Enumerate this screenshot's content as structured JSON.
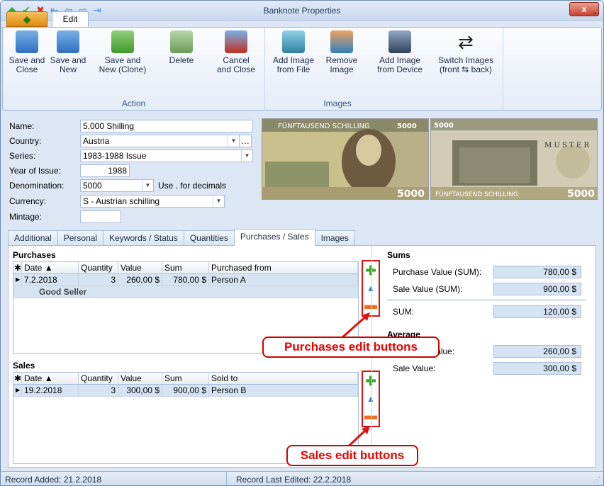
{
  "window": {
    "title": "Banknote Properties",
    "close_glyph": "x"
  },
  "ribbon": {
    "app_tab_glyph": "◆",
    "tab_edit": "Edit",
    "groups": {
      "action": "Action",
      "images": "Images"
    },
    "buttons": {
      "save_close": "Save and\nClose",
      "save_new": "Save and\nNew",
      "save_clone": "Save and\nNew (Clone)",
      "delete": "Delete",
      "cancel_close": "Cancel\nand Close",
      "add_image_file": "Add Image\nfrom File",
      "remove_image": "Remove\nImage",
      "add_image_device": "Add Image\nfrom Device",
      "switch_images": "Switch Images\n(front ⇆ back)"
    }
  },
  "form": {
    "name_label": "Name:",
    "name_value": "5,000 Shilling",
    "country_label": "Country:",
    "country_value": "Austria",
    "series_label": "Series:",
    "series_value": "1983-1988 Issue",
    "year_label": "Year of Issue:",
    "year_value": "1988",
    "denom_label": "Denomination:",
    "denom_value": "5000",
    "denom_hint": "Use . for decimals",
    "currency_label": "Currency:",
    "currency_value": "S - Austrian schilling",
    "mintage_label": "Mintage:",
    "mintage_value": ""
  },
  "banknote": {
    "front_text": "FÜNFTAUSEND SCHILLING",
    "front_value": "5000",
    "back_text": "FÜNFTAUSEND SCHILLING",
    "back_value": "5000",
    "back_label": "M U S T E R"
  },
  "tabs": [
    "Additional",
    "Personal",
    "Keywords / Status",
    "Quantities",
    "Purchases / Sales",
    "Images"
  ],
  "purchases": {
    "title": "Purchases",
    "columns": [
      "Date",
      "Quantity",
      "Value",
      "Sum",
      "Purchased from"
    ],
    "rows": [
      {
        "date": "7.2.2018",
        "quantity": "3",
        "value": "260,00 $",
        "sum": "780,00 $",
        "from": "Person A",
        "note": "Good Seller"
      }
    ]
  },
  "sales": {
    "title": "Sales",
    "columns": [
      "Date",
      "Quantity",
      "Value",
      "Sum",
      "Sold to"
    ],
    "rows": [
      {
        "date": "19.2.2018",
        "quantity": "3",
        "value": "300,00 $",
        "sum": "900,00 $",
        "to": "Person B"
      }
    ]
  },
  "sums": {
    "title": "Sums",
    "purchase_label": "Purchase Value (SUM):",
    "purchase_value": "780,00 $",
    "sale_label": "Sale Value (SUM):",
    "sale_value": "900,00 $",
    "sum_label": "SUM:",
    "sum_value": "120,00 $",
    "average_title": "Average",
    "avg_purchase_label": "Purchase Value:",
    "avg_purchase_value": "260,00 $",
    "avg_sale_label": "Sale Value:",
    "avg_sale_value": "300,00 $"
  },
  "callouts": {
    "purchases": "Purchases edit buttons",
    "sales": "Sales edit buttons"
  },
  "status": {
    "added": "Record Added: 21.2.2018",
    "edited": "Record Last Edited: 22.2.2018"
  },
  "colors": {
    "accent": "#e01010",
    "grid_row": "#d6e3f3",
    "frame": "#dce6f4"
  }
}
